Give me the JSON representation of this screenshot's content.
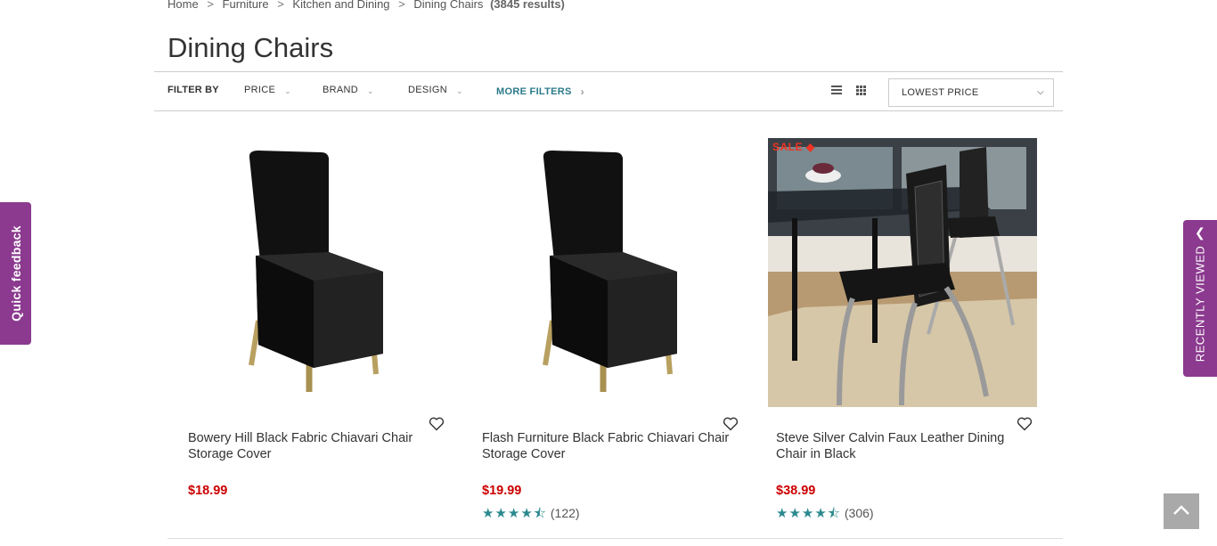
{
  "breadcrumb": {
    "items": [
      "Home",
      "Furniture",
      "Kitchen and Dining",
      "Dining Chairs"
    ],
    "separator": ">",
    "result_count": "(3845 results)"
  },
  "page_title": "Dining Chairs",
  "filters": {
    "label": "FILTER BY",
    "items": [
      "PRICE",
      "BRAND",
      "DESIGN"
    ],
    "more": "MORE FILTERS"
  },
  "sort": {
    "selected": "LOWEST PRICE"
  },
  "products": [
    {
      "name": "Bowery Hill Black Fabric Chiavari Chair Storage Cover",
      "price": "$18.99",
      "stars": 0,
      "reviews": ""
    },
    {
      "name": "Flash Furniture Black Fabric Chiavari Chair Storage Cover",
      "price": "$19.99",
      "stars": 4.5,
      "reviews": "(122)"
    },
    {
      "name": "Steve Silver Calvin Faux Leather Dining Chair in Black",
      "price": "$38.99",
      "stars": 4.5,
      "reviews": "(306)",
      "badge": "SALE"
    }
  ],
  "quick_feedback": "Quick feedback",
  "recently_viewed": "RECENTLY VIEWED",
  "colors": {
    "accent_purple": "#8b3a8f",
    "price_red": "#cc0000",
    "link_teal": "#2b7a8a",
    "star_teal": "#2b8a8e"
  },
  "icons": [
    "list-view-icon",
    "grid-view-icon",
    "heart-icon",
    "chevron-up-icon",
    "chevron-left-icon",
    "sale-tag-icon"
  ]
}
